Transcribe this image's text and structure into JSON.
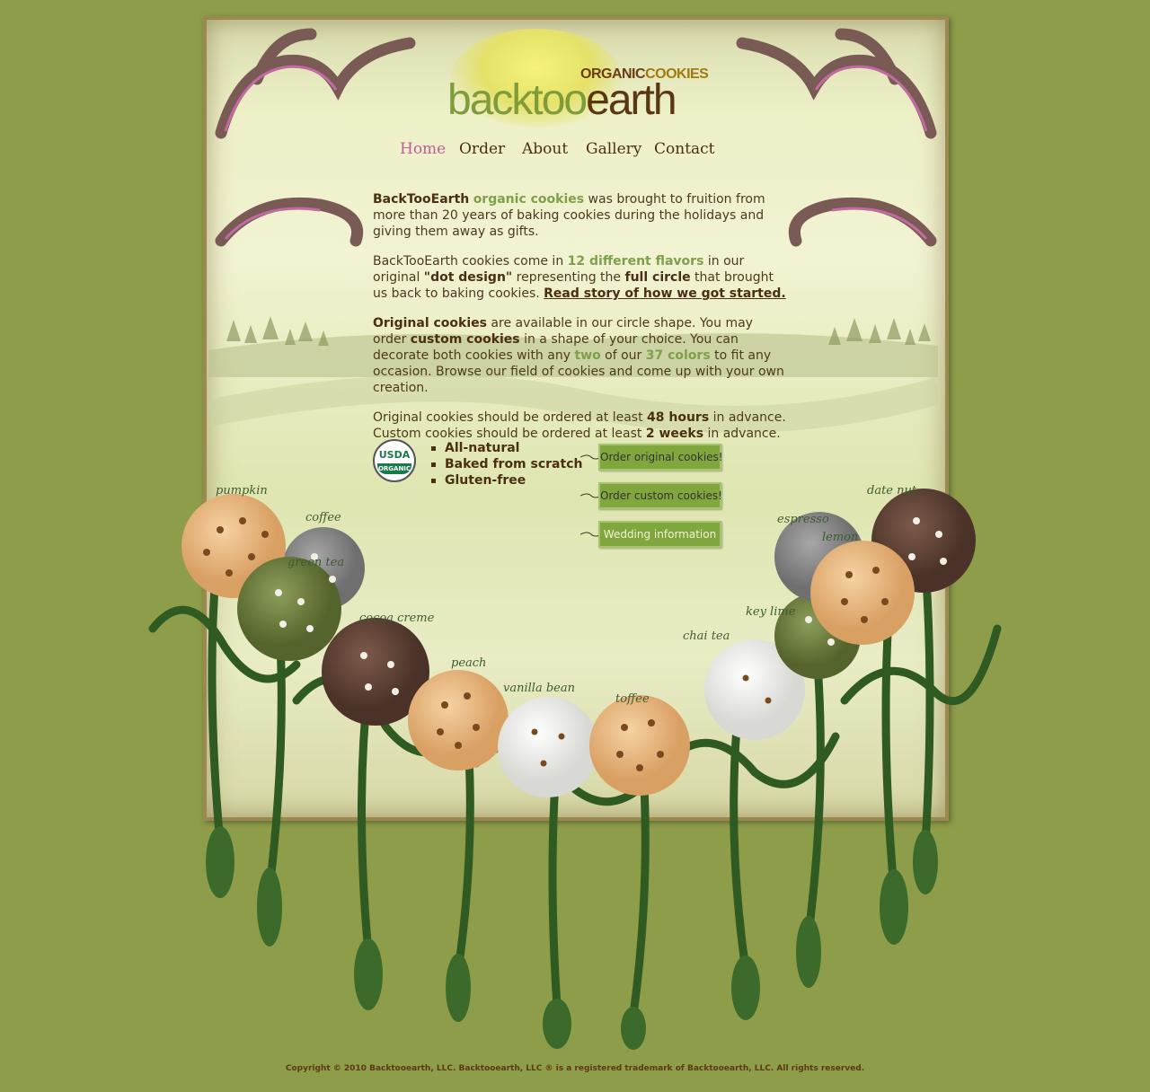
{
  "brand": {
    "tagline_a": "ORGANIC",
    "tagline_b": "COOKIES",
    "name_a": "backtoo",
    "name_b": "earth"
  },
  "nav": [
    {
      "label": "Home",
      "active": true
    },
    {
      "label": "Order"
    },
    {
      "label": "About"
    },
    {
      "label": "Gallery"
    },
    {
      "label": "Contact"
    }
  ],
  "intro": {
    "p1": {
      "a": "BackTooEarth",
      "b": "organic cookies",
      "c": " was brought to fruition from more than 20 years of baking cookies during the holidays and giving them away as gifts."
    },
    "p2": {
      "a": "BackTooEarth cookies come in ",
      "b": "12 different flavors",
      "c": " in our original ",
      "d": "\"dot design\"",
      "e": " representing the ",
      "f": "full circle",
      "g": " that brought us back to baking cookies. ",
      "link": "Read story of how we got started."
    },
    "p3": {
      "a": "Original cookies",
      "b": " are available in our circle shape. You may order ",
      "c": "custom cookies",
      "d": " in a shape of your choice. You can decorate both cookies with any ",
      "e": "two",
      "f": " of our ",
      "g": "37 colors",
      "h": " to fit any occasion. Browse our field of cookies and come up with your own creation."
    },
    "p4": {
      "a": "Original cookies should be ordered at least ",
      "b": "48 hours",
      "c": " in advance.",
      "d": "Custom cookies should be ordered at least ",
      "e": "2 weeks",
      "f": " in advance."
    }
  },
  "badge": {
    "top": "USDA",
    "bottom": "ORGANIC"
  },
  "features": [
    "All-natural",
    "Baked from scratch",
    "Gluten-free"
  ],
  "buttons": [
    "Order original cookies!",
    "Order custom cookies!",
    "Wedding information"
  ],
  "cookie_labels": [
    "pumpkin",
    "coffee",
    "green tea",
    "cocoa creme",
    "peach",
    "vanilla bean",
    "toffee",
    "chai tea",
    "key lime",
    "lemon",
    "espresso",
    "date nut"
  ],
  "footer": "Copyright © 2010 Backtooearth, LLC. Backtooearth, LLC ® is a registered trademark of Backtooearth, LLC. All rights reserved."
}
